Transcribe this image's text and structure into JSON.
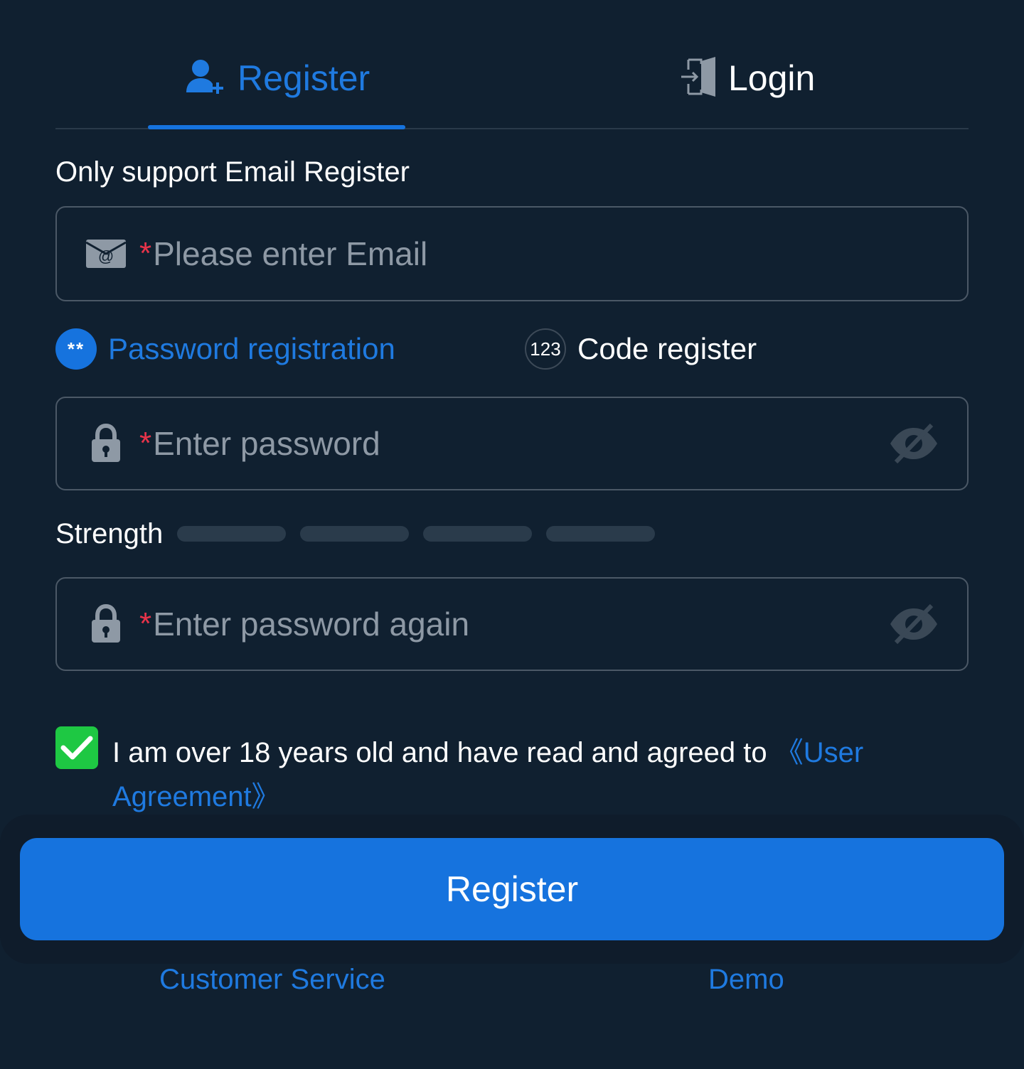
{
  "tabs": {
    "register_label": "Register",
    "login_label": "Login"
  },
  "form": {
    "hint": "Only support Email Register",
    "email_placeholder": "Please enter Email",
    "required_mark": "*",
    "mode_password": "Password registration",
    "mode_password_icon_text": "**",
    "mode_code": "Code register",
    "mode_code_icon_text": "123",
    "password_placeholder": "Enter password",
    "strength_label": "Strength",
    "password_again_placeholder": "Enter password again"
  },
  "agreement": {
    "text": "I am over 18 years old and have read and agreed to ",
    "link": "《User Agreement》",
    "checked": true
  },
  "actions": {
    "register_button": "Register"
  },
  "footer": {
    "customer_service": "Customer Service",
    "demo": "Demo"
  },
  "colors": {
    "background": "#102030",
    "accent": "#1673de",
    "accent_text": "#1f7ae0",
    "required": "#e8334a",
    "checkbox": "#1ec843",
    "strength_bar_empty": "#2a3b4b"
  },
  "icons": {
    "register_tab": "user-plus-icon",
    "login_tab": "door-enter-icon",
    "email_field": "email-icon",
    "password_field": "lock-icon",
    "password_toggle": "eye-off-icon",
    "checkbox": "check-icon"
  }
}
